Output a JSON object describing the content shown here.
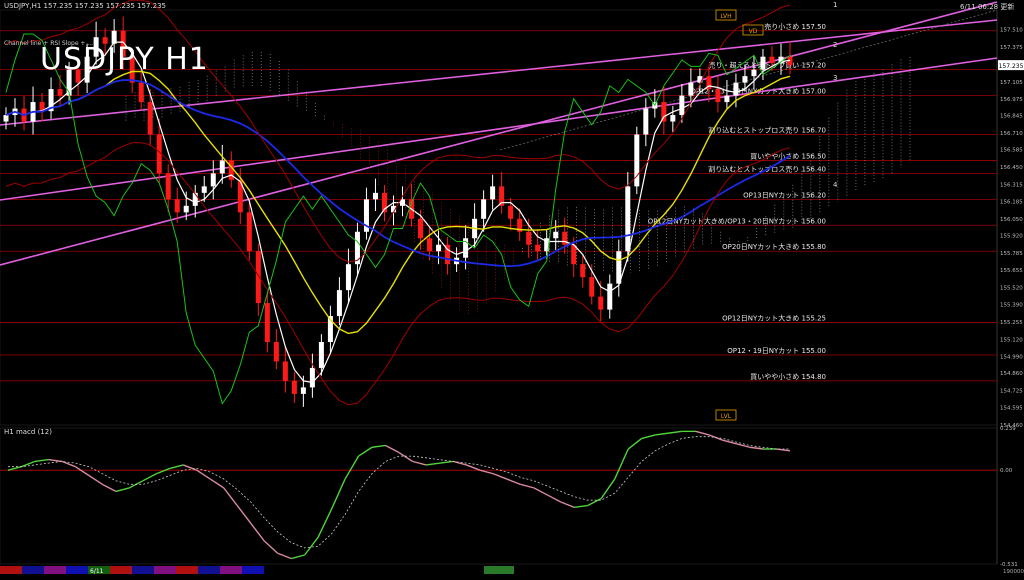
{
  "header": {
    "symbol_info": "USDJPY,H1  157.235 157.235 157.235 157.235",
    "datetime": "6/11 06:28 更新",
    "chart_title": "USDJPY H1",
    "sub_caption": "Channel line + RSI Slope + ...",
    "macd_label": "H1  macd (12)"
  },
  "colors": {
    "background": "#000000",
    "bull_candle": "#ffffff",
    "bear_candle": "#ff1a1a",
    "channel": "#e060e0",
    "ma_fast": "#ffffff",
    "ma_mid": "#e8e000",
    "ma_slow": "#1a2ae8",
    "chikou": "#19c219",
    "bollinger": "#a00000",
    "levels": "#a00000",
    "macd_main": "#4fd43a",
    "macd_signal": "#d88aa0"
  },
  "chart_data": [
    {
      "type": "candlestick",
      "title": "USDJPY H1",
      "ylim": [
        154.46,
        157.66
      ],
      "y_ticks": [
        "157.510",
        "157.375",
        "157.240",
        "157.105",
        "156.975",
        "156.845",
        "156.710",
        "156.585",
        "156.450",
        "156.315",
        "156.185",
        "156.050",
        "155.920",
        "155.785",
        "155.655",
        "155.520",
        "155.390",
        "155.255",
        "155.120",
        "154.990",
        "154.860",
        "154.725",
        "154.595",
        "154.460"
      ],
      "current_price": "157.235",
      "price_path": [
        156.85,
        156.9,
        156.8,
        156.95,
        156.88,
        157.05,
        157.0,
        157.2,
        157.1,
        157.3,
        157.45,
        157.4,
        157.5,
        157.3,
        157.1,
        156.95,
        156.7,
        156.4,
        156.2,
        156.1,
        156.15,
        156.25,
        156.3,
        156.4,
        156.5,
        156.35,
        156.1,
        155.8,
        155.4,
        155.1,
        154.95,
        154.8,
        154.7,
        154.75,
        154.9,
        155.1,
        155.3,
        155.5,
        155.7,
        155.95,
        156.2,
        156.25,
        156.1,
        156.15,
        156.2,
        156.05,
        155.9,
        155.8,
        155.85,
        155.7,
        155.75,
        155.9,
        156.05,
        156.2,
        156.3,
        156.15,
        156.05,
        155.95,
        155.85,
        155.8,
        155.9,
        155.95,
        155.85,
        155.7,
        155.6,
        155.45,
        155.35,
        155.55,
        155.8,
        156.3,
        156.7,
        156.9,
        156.95,
        156.8,
        156.85,
        157.0,
        157.1,
        157.15,
        157.05,
        156.95,
        157.0,
        157.1,
        157.15,
        157.2,
        157.3,
        157.25,
        157.3,
        157.235
      ],
      "horizontal_levels": [
        {
          "price": 157.5,
          "label": "売り小さめ 157.50"
        },
        {
          "price": 157.2,
          "label": "売り・超えるとストップ買い 157.20"
        },
        {
          "price": 157.0,
          "label": "OP12・13・14日NYカット大きめ 157.00"
        },
        {
          "price": 156.7,
          "label": "割り込むとストップロス売り 156.70"
        },
        {
          "price": 156.5,
          "label": "買いやや小さめ 156.50"
        },
        {
          "price": 156.4,
          "label": "割り込むとストップロス売り 156.40"
        },
        {
          "price": 156.2,
          "label": "OP13日NYカット 156.20"
        },
        {
          "price": 156.0,
          "label": "OP12日NYカット大きめ/OP13・20日NYカット 156.00"
        },
        {
          "price": 155.8,
          "label": "OP20日NYカット大きめ 155.80"
        },
        {
          "price": 155.25,
          "label": "OP12日NYカット大きめ 155.25"
        },
        {
          "price": 155.0,
          "label": "OP12・19日NYカット 155.00"
        },
        {
          "price": 154.8,
          "label": "買いやや小さめ 154.80"
        }
      ],
      "channel_labels": [
        "1",
        "2",
        "3",
        "4"
      ],
      "box_labels": [
        "LVH",
        "LVL",
        "VD"
      ]
    },
    {
      "type": "line",
      "title": "H1  macd (12)",
      "ylim": [
        -0.531,
        0.239
      ],
      "y_ticks": [
        "0.239",
        "0.00",
        "-0.531"
      ],
      "series": [
        {
          "values": [
            0.0,
            0.02,
            0.05,
            0.06,
            0.05,
            0.02,
            -0.03,
            -0.08,
            -0.12,
            -0.1,
            -0.06,
            -0.02,
            0.01,
            0.03,
            0.0,
            -0.05,
            -0.1,
            -0.2,
            -0.3,
            -0.4,
            -0.47,
            -0.5,
            -0.48,
            -0.38,
            -0.22,
            -0.05,
            0.08,
            0.13,
            0.14,
            0.1,
            0.05,
            0.03,
            0.04,
            0.05,
            0.03,
            0.0,
            -0.02,
            -0.05,
            -0.08,
            -0.1,
            -0.14,
            -0.18,
            -0.21,
            -0.2,
            -0.16,
            -0.05,
            0.12,
            0.18,
            0.2,
            0.21,
            0.22,
            0.22,
            0.2,
            0.17,
            0.15,
            0.13,
            0.12,
            0.12,
            0.11
          ]
        },
        {
          "values": [
            0.02,
            0.02,
            0.03,
            0.04,
            0.05,
            0.04,
            0.02,
            -0.02,
            -0.06,
            -0.08,
            -0.08,
            -0.06,
            -0.03,
            0.0,
            0.01,
            -0.01,
            -0.05,
            -0.11,
            -0.18,
            -0.27,
            -0.35,
            -0.41,
            -0.44,
            -0.43,
            -0.36,
            -0.25,
            -0.12,
            -0.02,
            0.05,
            0.08,
            0.08,
            0.07,
            0.06,
            0.05,
            0.04,
            0.03,
            0.01,
            -0.01,
            -0.04,
            -0.06,
            -0.09,
            -0.12,
            -0.15,
            -0.17,
            -0.17,
            -0.13,
            -0.04,
            0.05,
            0.11,
            0.15,
            0.18,
            0.19,
            0.19,
            0.18,
            0.16,
            0.14,
            0.13,
            0.12,
            0.12
          ]
        }
      ]
    }
  ],
  "timebar": {
    "date_label": "6/11",
    "right_label": "190000"
  }
}
